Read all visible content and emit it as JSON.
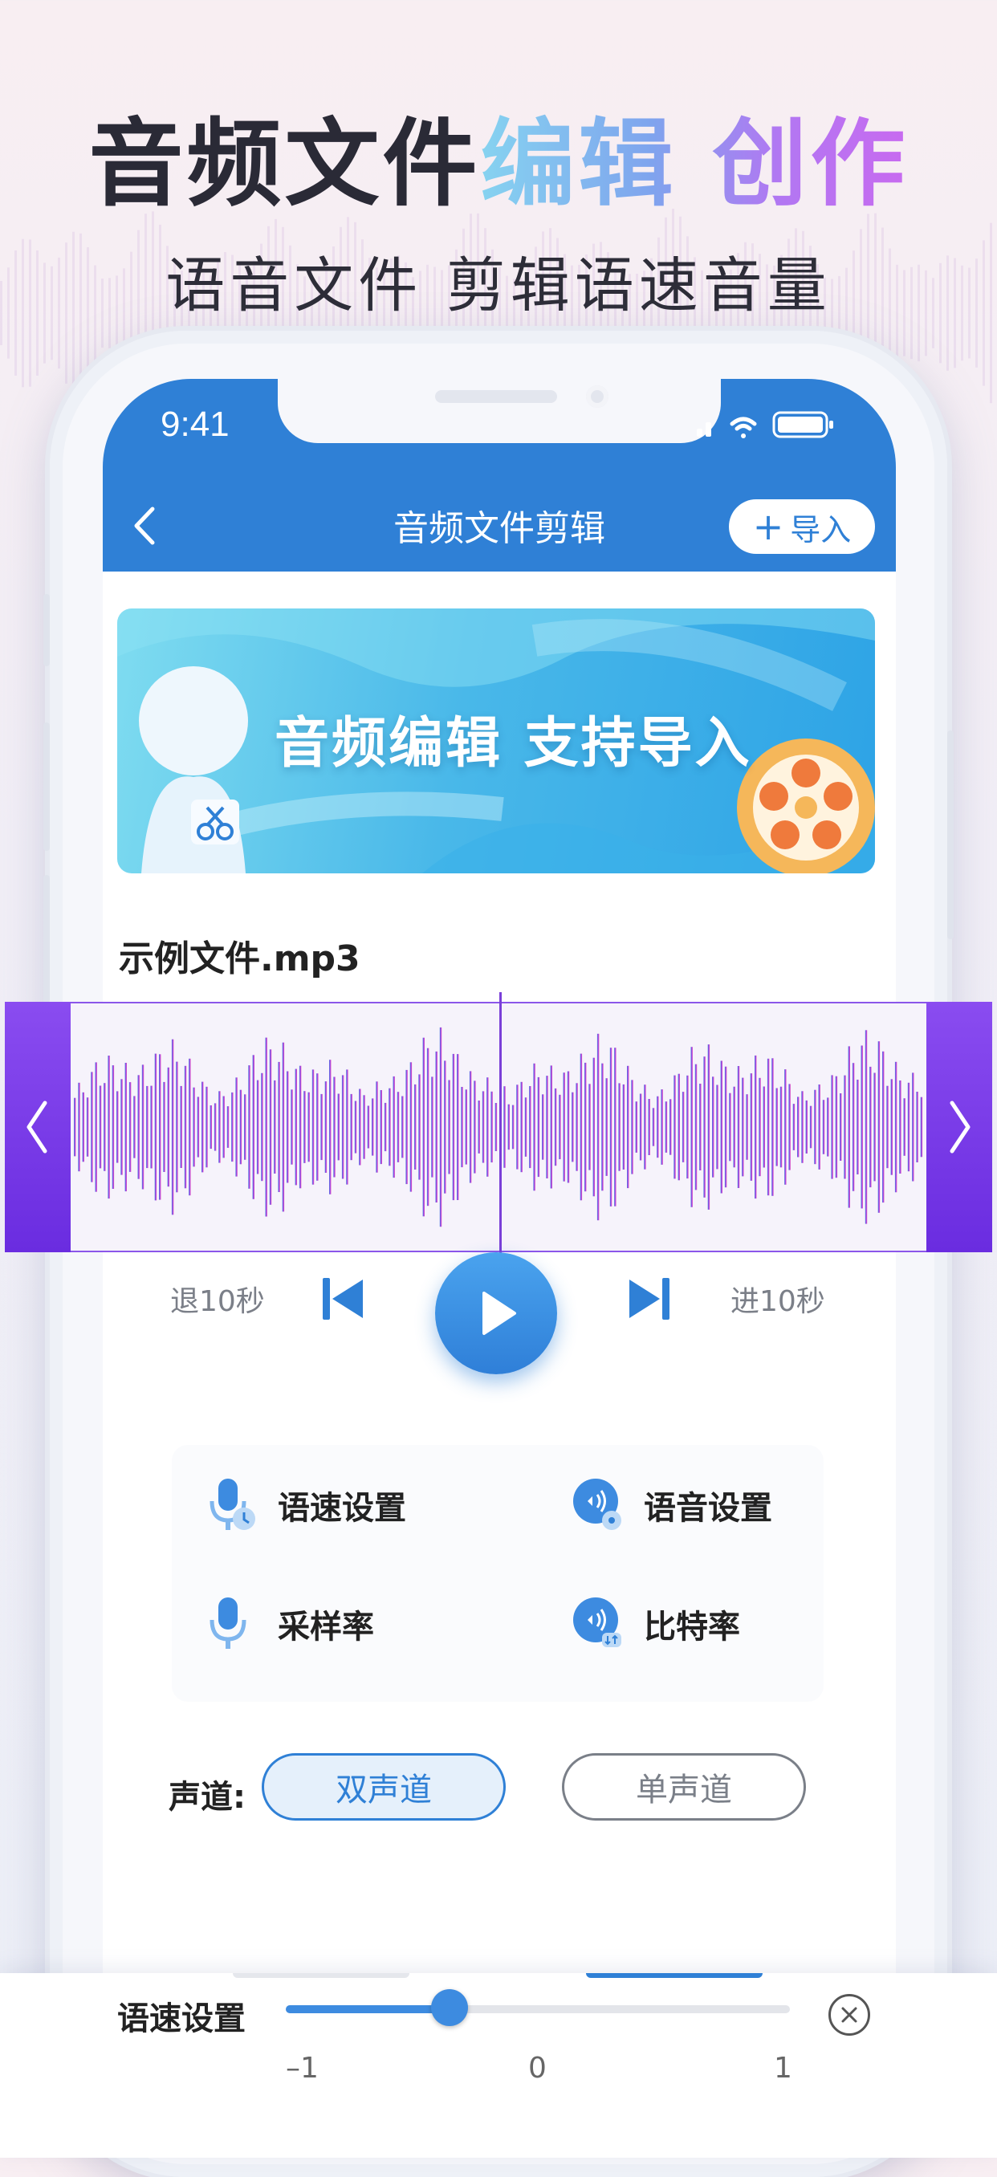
{
  "headline": {
    "part1": "音频文件",
    "part2": "编辑 创作"
  },
  "subline": "语音文件 剪辑语速音量",
  "status_bar": {
    "time": "9:41"
  },
  "nav": {
    "title": "音频文件剪辑",
    "import_plus": "+",
    "import_label": "导入"
  },
  "banner": {
    "text": "音频编辑 支持导入"
  },
  "file_name": "示例文件.mp3",
  "controls": {
    "back_label": "退10秒",
    "forward_label": "进10秒"
  },
  "settings": [
    {
      "label": "语速设置",
      "icon": "mic-speed-icon"
    },
    {
      "label": "语音设置",
      "icon": "voice-settings-icon"
    },
    {
      "label": "采样率",
      "icon": "mic-sample-icon"
    },
    {
      "label": "比特率",
      "icon": "bitrate-icon"
    }
  ],
  "channel": {
    "label": "声道:",
    "options": [
      "双声道",
      "单声道"
    ],
    "selected": "双声道"
  },
  "speed_slider": {
    "label": "语速设置",
    "min_label": "–1",
    "mid_label": "0",
    "max_label": "1",
    "min": -1,
    "max": 1,
    "value": -0.35
  },
  "colors": {
    "primary": "#2f80d6",
    "purple": "#7a3fd8",
    "accent_grad_start": "#86d3f0",
    "accent_grad_end": "#c86af0"
  }
}
